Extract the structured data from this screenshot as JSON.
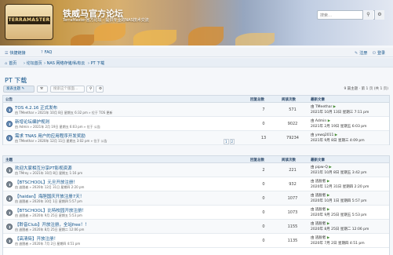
{
  "header": {
    "logo_text": "TERRAMASTER",
    "site_title": "铁威马官方论坛",
    "site_desc": "TerraMaster官方论坛 - 提供专业的NAS技术交流",
    "search_placeholder": "搜索…",
    "search_icon": "search-icon",
    "settings_icon": "gear-icon"
  },
  "nav": {
    "quick_links": "快捷链接",
    "faq": "FAQ",
    "register": "注册",
    "login": "登录"
  },
  "breadcrumb": {
    "home": "首页",
    "forum_index": "论坛首页",
    "category": "NAS 网络存储/私有云",
    "current": "PT 下载"
  },
  "page": {
    "title": "PT 下载",
    "new_topic": "发表主题",
    "search_placeholder": "搜索这个版面…",
    "pagination": "9 篇主题 · 第 1 页 (共 1 页)"
  },
  "announcements": {
    "header": {
      "label": "公告",
      "replies": "回复总数",
      "views": "阅读次数",
      "last_post": "最新文章"
    },
    "rows": [
      {
        "title": "TOS 4.2.16 正式发布",
        "meta": "由 TMeethar » 2021年 10月 8日 星期五 6:32 pm » 位于 TOS 更新",
        "author": "TMeethar",
        "replies": "7",
        "views": "571",
        "last_by": "由 TMeethar",
        "last_time": "2021年 10月 13日 星期三 7:11 pm"
      },
      {
        "title": "新增论坛编护规则",
        "meta": "由 Admin » 2021年 2月 19日 星期五 6:03 pm » 位于 公告",
        "author": "Admin",
        "replies": "0",
        "views": "9022",
        "last_by": "由 Admin",
        "last_time": "2021年 2月 19日 星期五 6:03 pm"
      },
      {
        "title": "需求 TNAS 用户的应用程序开发奖励",
        "meta": "由 TMeethar » 2020年 12月 11日 星期五 3:02 pm » 位于 公告",
        "author": "TMeethar",
        "replies": "13",
        "views": "79234",
        "pages": [
          "1",
          "2"
        ],
        "last_by": "由 yewq2011",
        "last_time": "2021年 9月 8日 星期三 4:09 pm"
      }
    ]
  },
  "topics": {
    "header": {
      "label": "主题",
      "replies": "回复总数",
      "views": "阅读次数",
      "last_post": "最新文章"
    },
    "rows": [
      {
        "title": "欢迎大家相互分享PT影视资源",
        "meta": "由 TMrey » 2021年 10月 8日 星期五 1:16 pm",
        "replies": "2",
        "views": "221",
        "last_by": "由 pipw-Q",
        "last_time": "2021年 10月 8日 星期五 3:42 pm"
      },
      {
        "title": "【BTSCHOOL】元旦开放注册！",
        "meta": "由 逃脱者 » 2020年 12月 31日 星期四 2:20 pm",
        "replies": "0",
        "views": "932",
        "last_by": "由 逃脱者",
        "last_time": "2020年 12月 31日 星期四 2:20 pm"
      },
      {
        "title": "【haidan】海胆国庆开放注册7天！",
        "meta": "由 逃脱者 » 2020年 10月 1日 星期四 5:57 pm",
        "replies": "0",
        "views": "1077",
        "last_by": "由 逃脱者",
        "last_time": "2020年 10月 1日 星期四 5:57 pm"
      },
      {
        "title": "【BTSCHOOL】比特校园开放注册！",
        "meta": "由 逃脱者 » 2020年 9月 25日 星期五 5:53 pm",
        "replies": "0",
        "views": "1073",
        "last_by": "由 逃脱者",
        "last_time": "2020年 9月 25日 星期五 5:53 pm"
      },
      {
        "title": "【聆音Club】开放注册，全站free！！",
        "meta": "由 逃脱者 » 2020年 8月 25日 星期二 12:06 pm",
        "replies": "0",
        "views": "1155",
        "last_by": "由 逃脱者",
        "last_time": "2020年 8月 25日 星期二 12:06 pm"
      },
      {
        "title": "【高清街】开放注册！",
        "meta": "由 逃脱者 » 2020年 7月 2日 星期四 4:51 pm",
        "replies": "0",
        "views": "1135",
        "last_by": "由 逃脱者",
        "last_time": "2020年 7月 2日 星期四 4:51 pm"
      }
    ]
  },
  "colors": {
    "link": "#105289",
    "author": "#c6221d",
    "header_bg": "#e8eff6"
  }
}
